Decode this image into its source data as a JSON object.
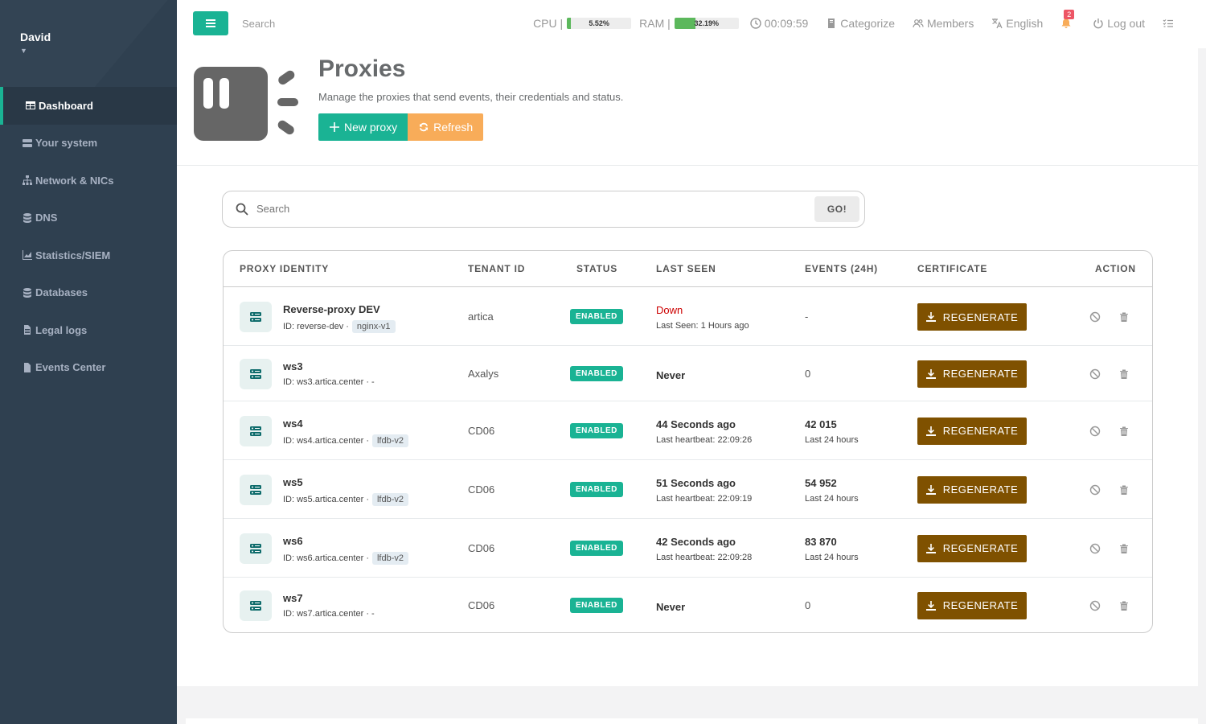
{
  "sidebar": {
    "user": "David",
    "items": [
      {
        "label": "Dashboard",
        "icon": "table-icon"
      },
      {
        "label": "Your system",
        "icon": "server-icon"
      },
      {
        "label": "Network & NICs",
        "icon": "sitemap-icon"
      },
      {
        "label": "DNS",
        "icon": "database-icon"
      },
      {
        "label": "Statistics/SIEM",
        "icon": "chart-icon"
      },
      {
        "label": "Databases",
        "icon": "database-icon"
      },
      {
        "label": "Legal logs",
        "icon": "file-icon"
      },
      {
        "label": "Events Center",
        "icon": "file-icon"
      }
    ]
  },
  "topbar": {
    "search_placeholder": "Search",
    "cpu_label": "CPU |",
    "cpu_value": "5.52%",
    "cpu_percent": 5.52,
    "ram_label": "RAM |",
    "ram_value": "32.19%",
    "ram_percent": 32.19,
    "uptime": "00:09:59",
    "categorize": "Categorize",
    "members": "Members",
    "language": "English",
    "notifications": "2",
    "logout": "Log out"
  },
  "header": {
    "title": "Proxies",
    "subtitle": "Manage the proxies that send events, their credentials and status.",
    "new_proxy": "New proxy",
    "refresh": "Refresh"
  },
  "search": {
    "placeholder": "Search",
    "go": "GO!"
  },
  "table": {
    "columns": [
      "PROXY IDENTITY",
      "TENANT ID",
      "STATUS",
      "LAST SEEN",
      "EVENTS (24H)",
      "CERTIFICATE",
      "ACTION"
    ],
    "regenerate_label": "REGENERATE",
    "rows": [
      {
        "name": "Reverse-proxy DEV",
        "id": "ID: reverse-dev ·",
        "tag": "nginx-v1",
        "tenant": "artica",
        "status": "ENABLED",
        "last_seen": "Down",
        "last_seen_sub": "Last Seen: 1 Hours ago",
        "events": "-",
        "events_sub": ""
      },
      {
        "name": "ws3",
        "id": "ID: ws3.artica.center · -",
        "tag": "",
        "tenant": "Axalys",
        "status": "ENABLED",
        "last_seen": "Never",
        "last_seen_sub": "",
        "events": "0",
        "events_sub": ""
      },
      {
        "name": "ws4",
        "id": "ID: ws4.artica.center ·",
        "tag": "lfdb-v2",
        "tenant": "CD06",
        "status": "ENABLED",
        "last_seen": "44 Seconds ago",
        "last_seen_sub": "Last heartbeat: 22:09:26",
        "events": "42 015",
        "events_sub": "Last 24 hours"
      },
      {
        "name": "ws5",
        "id": "ID: ws5.artica.center ·",
        "tag": "lfdb-v2",
        "tenant": "CD06",
        "status": "ENABLED",
        "last_seen": "51 Seconds ago",
        "last_seen_sub": "Last heartbeat: 22:09:19",
        "events": "54 952",
        "events_sub": "Last 24 hours"
      },
      {
        "name": "ws6",
        "id": "ID: ws6.artica.center ·",
        "tag": "lfdb-v2",
        "tenant": "CD06",
        "status": "ENABLED",
        "last_seen": "42 Seconds ago",
        "last_seen_sub": "Last heartbeat: 22:09:28",
        "events": "83 870",
        "events_sub": "Last 24 hours"
      },
      {
        "name": "ws7",
        "id": "ID: ws7.artica.center · -",
        "tag": "",
        "tenant": "CD06",
        "status": "ENABLED",
        "last_seen": "Never",
        "last_seen_sub": "",
        "events": "0",
        "events_sub": ""
      }
    ]
  },
  "colors": {
    "accent": "#1ab394",
    "sidebar": "#2f4050",
    "warning": "#f8ac59",
    "regenerate": "#7f5100",
    "down": "#cc0000"
  }
}
